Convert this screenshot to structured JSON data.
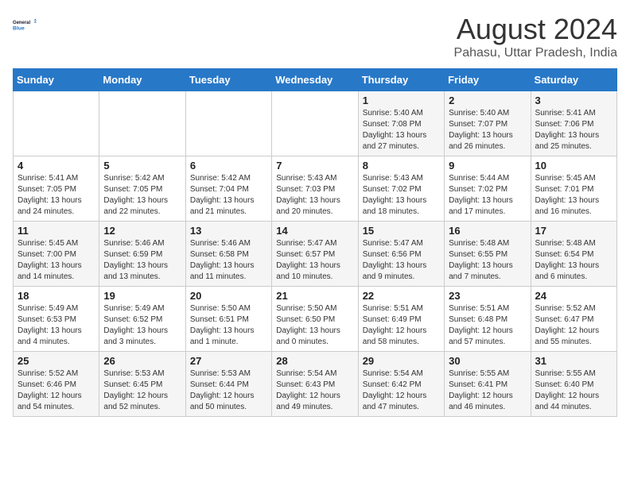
{
  "header": {
    "logo_line1": "General",
    "logo_line2": "Blue",
    "month_year": "August 2024",
    "location": "Pahasu, Uttar Pradesh, India"
  },
  "days_of_week": [
    "Sunday",
    "Monday",
    "Tuesday",
    "Wednesday",
    "Thursday",
    "Friday",
    "Saturday"
  ],
  "weeks": [
    [
      {
        "day": "",
        "info": ""
      },
      {
        "day": "",
        "info": ""
      },
      {
        "day": "",
        "info": ""
      },
      {
        "day": "",
        "info": ""
      },
      {
        "day": "1",
        "info": "Sunrise: 5:40 AM\nSunset: 7:08 PM\nDaylight: 13 hours\nand 27 minutes."
      },
      {
        "day": "2",
        "info": "Sunrise: 5:40 AM\nSunset: 7:07 PM\nDaylight: 13 hours\nand 26 minutes."
      },
      {
        "day": "3",
        "info": "Sunrise: 5:41 AM\nSunset: 7:06 PM\nDaylight: 13 hours\nand 25 minutes."
      }
    ],
    [
      {
        "day": "4",
        "info": "Sunrise: 5:41 AM\nSunset: 7:05 PM\nDaylight: 13 hours\nand 24 minutes."
      },
      {
        "day": "5",
        "info": "Sunrise: 5:42 AM\nSunset: 7:05 PM\nDaylight: 13 hours\nand 22 minutes."
      },
      {
        "day": "6",
        "info": "Sunrise: 5:42 AM\nSunset: 7:04 PM\nDaylight: 13 hours\nand 21 minutes."
      },
      {
        "day": "7",
        "info": "Sunrise: 5:43 AM\nSunset: 7:03 PM\nDaylight: 13 hours\nand 20 minutes."
      },
      {
        "day": "8",
        "info": "Sunrise: 5:43 AM\nSunset: 7:02 PM\nDaylight: 13 hours\nand 18 minutes."
      },
      {
        "day": "9",
        "info": "Sunrise: 5:44 AM\nSunset: 7:02 PM\nDaylight: 13 hours\nand 17 minutes."
      },
      {
        "day": "10",
        "info": "Sunrise: 5:45 AM\nSunset: 7:01 PM\nDaylight: 13 hours\nand 16 minutes."
      }
    ],
    [
      {
        "day": "11",
        "info": "Sunrise: 5:45 AM\nSunset: 7:00 PM\nDaylight: 13 hours\nand 14 minutes."
      },
      {
        "day": "12",
        "info": "Sunrise: 5:46 AM\nSunset: 6:59 PM\nDaylight: 13 hours\nand 13 minutes."
      },
      {
        "day": "13",
        "info": "Sunrise: 5:46 AM\nSunset: 6:58 PM\nDaylight: 13 hours\nand 11 minutes."
      },
      {
        "day": "14",
        "info": "Sunrise: 5:47 AM\nSunset: 6:57 PM\nDaylight: 13 hours\nand 10 minutes."
      },
      {
        "day": "15",
        "info": "Sunrise: 5:47 AM\nSunset: 6:56 PM\nDaylight: 13 hours\nand 9 minutes."
      },
      {
        "day": "16",
        "info": "Sunrise: 5:48 AM\nSunset: 6:55 PM\nDaylight: 13 hours\nand 7 minutes."
      },
      {
        "day": "17",
        "info": "Sunrise: 5:48 AM\nSunset: 6:54 PM\nDaylight: 13 hours\nand 6 minutes."
      }
    ],
    [
      {
        "day": "18",
        "info": "Sunrise: 5:49 AM\nSunset: 6:53 PM\nDaylight: 13 hours\nand 4 minutes."
      },
      {
        "day": "19",
        "info": "Sunrise: 5:49 AM\nSunset: 6:52 PM\nDaylight: 13 hours\nand 3 minutes."
      },
      {
        "day": "20",
        "info": "Sunrise: 5:50 AM\nSunset: 6:51 PM\nDaylight: 13 hours\nand 1 minute."
      },
      {
        "day": "21",
        "info": "Sunrise: 5:50 AM\nSunset: 6:50 PM\nDaylight: 13 hours\nand 0 minutes."
      },
      {
        "day": "22",
        "info": "Sunrise: 5:51 AM\nSunset: 6:49 PM\nDaylight: 12 hours\nand 58 minutes."
      },
      {
        "day": "23",
        "info": "Sunrise: 5:51 AM\nSunset: 6:48 PM\nDaylight: 12 hours\nand 57 minutes."
      },
      {
        "day": "24",
        "info": "Sunrise: 5:52 AM\nSunset: 6:47 PM\nDaylight: 12 hours\nand 55 minutes."
      }
    ],
    [
      {
        "day": "25",
        "info": "Sunrise: 5:52 AM\nSunset: 6:46 PM\nDaylight: 12 hours\nand 54 minutes."
      },
      {
        "day": "26",
        "info": "Sunrise: 5:53 AM\nSunset: 6:45 PM\nDaylight: 12 hours\nand 52 minutes."
      },
      {
        "day": "27",
        "info": "Sunrise: 5:53 AM\nSunset: 6:44 PM\nDaylight: 12 hours\nand 50 minutes."
      },
      {
        "day": "28",
        "info": "Sunrise: 5:54 AM\nSunset: 6:43 PM\nDaylight: 12 hours\nand 49 minutes."
      },
      {
        "day": "29",
        "info": "Sunrise: 5:54 AM\nSunset: 6:42 PM\nDaylight: 12 hours\nand 47 minutes."
      },
      {
        "day": "30",
        "info": "Sunrise: 5:55 AM\nSunset: 6:41 PM\nDaylight: 12 hours\nand 46 minutes."
      },
      {
        "day": "31",
        "info": "Sunrise: 5:55 AM\nSunset: 6:40 PM\nDaylight: 12 hours\nand 44 minutes."
      }
    ]
  ]
}
